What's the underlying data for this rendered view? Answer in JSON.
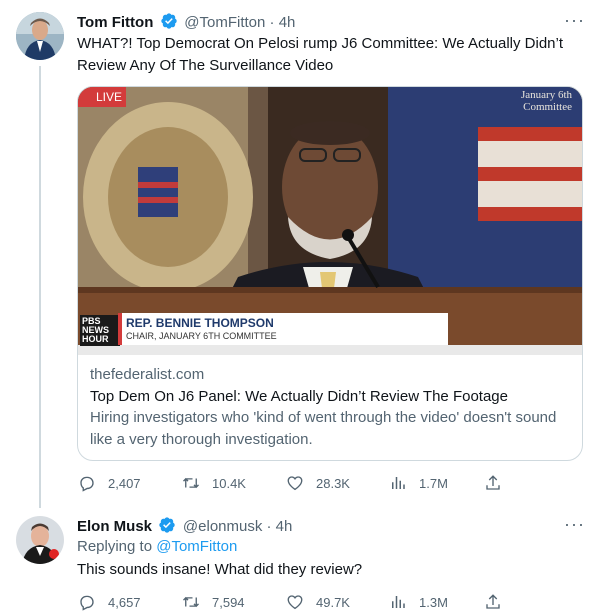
{
  "colors": {
    "accent": "#1d9bf0",
    "muted": "#536471",
    "verified": "#1d9bf0"
  },
  "tweet1": {
    "name": "Tom Fitton",
    "handle": "@TomFitton · 4h",
    "text": "WHAT?! Top Democrat On Pelosi rump J6 Committee: We Actually Didn’t Review Any Of The Surveillance Video",
    "card": {
      "live_badge": "LIVE",
      "watermark": "January 6th Committee",
      "pbs_logo": "PBS NEWS HOUR",
      "lower_third_name": "REP. BENNIE THOMPSON",
      "lower_third_title": "CHAIR, JANUARY 6TH COMMITTEE",
      "domain": "thefederalist.com",
      "title": "Top Dem On J6 Panel: We Actually Didn’t Review The Footage",
      "description": "Hiring investigators who 'kind of went through the video' doesn't sound like a very thorough investigation."
    },
    "actions": {
      "replies": "2,407",
      "retweets": "10.4K",
      "likes": "28.3K",
      "views": "1.7M"
    }
  },
  "tweet2": {
    "name": "Elon Musk",
    "handle": "@elonmusk · 4h",
    "replying_prefix": "Replying to ",
    "replying_to": "@TomFitton",
    "text": "This sounds insane! What did they review?",
    "actions": {
      "replies": "4,657",
      "retweets": "7,594",
      "likes": "49.7K",
      "views": "1.3M"
    }
  },
  "icons": [
    "verified-badge-icon",
    "more-icon",
    "reply-icon",
    "retweet-icon",
    "like-icon",
    "views-icon",
    "share-icon"
  ]
}
